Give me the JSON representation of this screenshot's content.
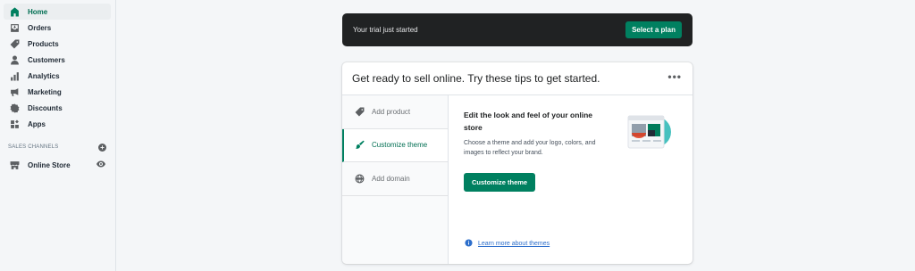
{
  "sidebar": {
    "items": [
      {
        "label": "Home",
        "icon": "home-icon"
      },
      {
        "label": "Orders",
        "icon": "orders-icon"
      },
      {
        "label": "Products",
        "icon": "tag-icon"
      },
      {
        "label": "Customers",
        "icon": "person-icon"
      },
      {
        "label": "Analytics",
        "icon": "bar-chart-icon"
      },
      {
        "label": "Marketing",
        "icon": "megaphone-icon"
      },
      {
        "label": "Discounts",
        "icon": "discount-icon"
      },
      {
        "label": "Apps",
        "icon": "apps-icon"
      }
    ],
    "channels_label": "SALES CHANNELS",
    "online_store_label": "Online Store"
  },
  "trial": {
    "text": "Your trial just started",
    "button": "Select a plan"
  },
  "tips": {
    "title": "Get ready to sell online. Try these tips to get started.",
    "more": "•••",
    "tabs": [
      {
        "label": "Add product",
        "icon": "tag-icon"
      },
      {
        "label": "Customize theme",
        "icon": "brush-icon"
      },
      {
        "label": "Add domain",
        "icon": "globe-icon"
      }
    ],
    "panel": {
      "title": "Edit the look and feel of your online store",
      "description": "Choose a theme and add your logo, colors, and images to reflect your brand.",
      "button": "Customize theme",
      "learn_link": "Learn more about themes"
    }
  },
  "colors": {
    "accent": "#008060",
    "banner": "#202223",
    "link": "#2c6ecb"
  }
}
